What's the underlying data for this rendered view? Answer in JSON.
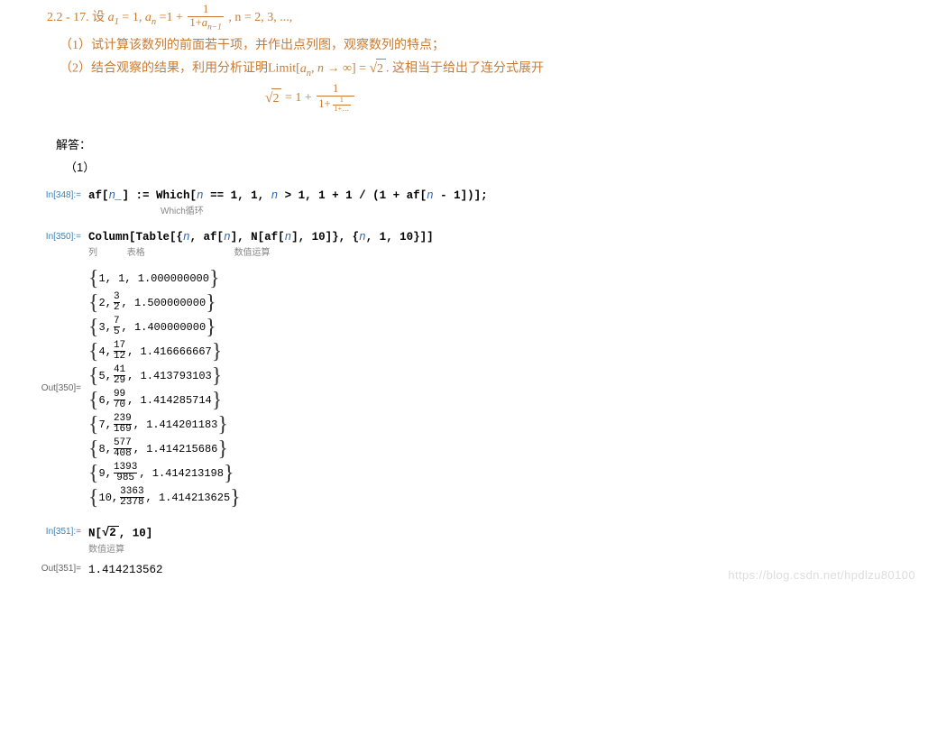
{
  "problem": {
    "head": "2.2 - 17. 设 ",
    "a1": "a",
    "eq1": " = 1, ",
    "an": "a",
    "eq2": "=1 + ",
    "frac1num": "1",
    "frac1den_pre": "1+",
    "frac1den_a": "a",
    "tail1": ", n = 2, 3, ...,",
    "p1": "（1）试计算该数列的前面若干项，并作出点列图，观察数列的特点；",
    "p2a": "（2）结合观察的结果，利用分析证明Limit[",
    "p2_an": "a",
    "p2b": ", ",
    "p2_n": "n",
    "p2c": " → ∞] = ",
    "sqrt2": "2",
    "p2d": ". 这相当于给出了连分式展开",
    "eq3_pre": " = 1 + ",
    "cfrac_n1": "1",
    "cfrac_d1_pre": "1+",
    "cfrac_n2": "1",
    "cfrac_d2": "1+…"
  },
  "answer": {
    "title": "解答：",
    "s1": "（1）"
  },
  "cells": {
    "in1_label": "In[348]:=",
    "in1_code": "af[n_] := Which[n == 1, 1, n > 1, 1 + 1 / (1 + af[n - 1])];",
    "in1_hint": "Which循环",
    "in2_label": "In[350]:=",
    "in2_code": "Column[Table[{n, af[n], N[af[n], 10]}, {n, 1, 10}]]",
    "in2_hint_col": "列",
    "in2_hint_tab": "表格",
    "in2_hint_n": "数值运算",
    "out2_label": "Out[350]=",
    "in3_label": "In[351]:=",
    "in3_codeA": "N[",
    "in3_codeB": ", 10]",
    "in3_hint": "数值运算",
    "out3_label": "Out[351]=",
    "out3_val": "1.414213562"
  },
  "table": [
    {
      "n": "1",
      "fracN": "1",
      "fracD": "",
      "dec": "1.000000000",
      "plain": true
    },
    {
      "n": "2",
      "fracN": "3",
      "fracD": "2",
      "dec": "1.500000000"
    },
    {
      "n": "3",
      "fracN": "7",
      "fracD": "5",
      "dec": "1.400000000"
    },
    {
      "n": "4",
      "fracN": "17",
      "fracD": "12",
      "dec": "1.416666667"
    },
    {
      "n": "5",
      "fracN": "41",
      "fracD": "29",
      "dec": "1.413793103"
    },
    {
      "n": "6",
      "fracN": "99",
      "fracD": "70",
      "dec": "1.414285714"
    },
    {
      "n": "7",
      "fracN": "239",
      "fracD": "169",
      "dec": "1.414201183"
    },
    {
      "n": "8",
      "fracN": "577",
      "fracD": "408",
      "dec": "1.414215686"
    },
    {
      "n": "9",
      "fracN": "1393",
      "fracD": "985",
      "dec": "1.414213198"
    },
    {
      "n": "10",
      "fracN": "3363",
      "fracD": "2378",
      "dec": "1.414213625"
    }
  ],
  "watermark": "https://blog.csdn.net/hpdlzu80100"
}
